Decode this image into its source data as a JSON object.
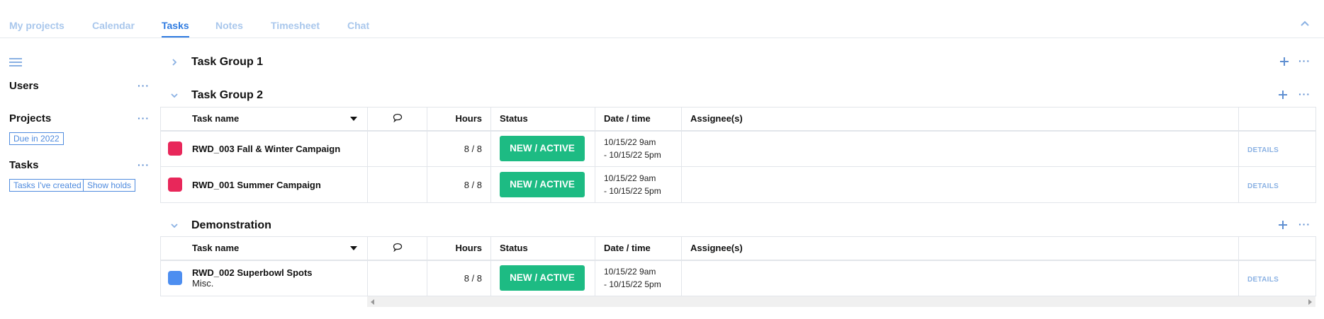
{
  "nav": {
    "tabs": [
      {
        "label": "My projects"
      },
      {
        "label": "Calendar"
      },
      {
        "label": "Tasks"
      },
      {
        "label": "Notes"
      },
      {
        "label": "Timesheet"
      },
      {
        "label": "Chat"
      }
    ],
    "active_tab": "Tasks"
  },
  "sidebar": {
    "sections": [
      {
        "title": "Users",
        "more": "···"
      },
      {
        "title": "Projects",
        "more": "···",
        "chips": [
          "Due in 2022"
        ]
      },
      {
        "title": "Tasks",
        "more": "···",
        "chips": [
          "Tasks I've created",
          "Show holds"
        ]
      }
    ]
  },
  "columns": {
    "name": "Task name",
    "hours": "Hours",
    "status": "Status",
    "date": "Date / time",
    "assignees": "Assignee(s)"
  },
  "groups": [
    {
      "title": "Task Group 1",
      "expanded": false,
      "tasks": []
    },
    {
      "title": "Task Group 2",
      "expanded": true,
      "tasks": [
        {
          "name": "RWD_003 Fall & Winter Campaign",
          "sub": "",
          "color": "#e8275a",
          "hours": "8 / 8",
          "status": "NEW / ACTIVE",
          "date_start": "10/15/22 9am",
          "date_end": "- 10/15/22 5pm",
          "details": "DETAILS"
        },
        {
          "name": "RWD_001 Summer Campaign",
          "sub": "",
          "color": "#e8275a",
          "hours": "8 / 8",
          "status": "NEW / ACTIVE",
          "date_start": "10/15/22 9am",
          "date_end": "- 10/15/22 5pm",
          "details": "DETAILS"
        }
      ]
    },
    {
      "title": "Demonstration",
      "expanded": true,
      "tasks": [
        {
          "name": "RWD_002 Superbowl Spots",
          "sub": "Misc.",
          "color": "#4d8ef0",
          "hours": "8 / 8",
          "status": "NEW / ACTIVE",
          "date_start": "10/15/22 9am",
          "date_end": "- 10/15/22 5pm",
          "details": "DETAILS"
        }
      ]
    }
  ],
  "colors": {
    "accent": "#2f7be0",
    "status_green": "#1dbb83",
    "task_red": "#e8275a",
    "task_blue": "#4d8ef0"
  },
  "icons": {
    "collapse": "chevron-up-icon",
    "menu": "hamburger-icon",
    "add": "plus-icon",
    "more": "more-dots-icon",
    "comments": "comment-bubble-icon",
    "expand": "chevron-right-icon",
    "collapse_group": "chevron-down-icon"
  }
}
